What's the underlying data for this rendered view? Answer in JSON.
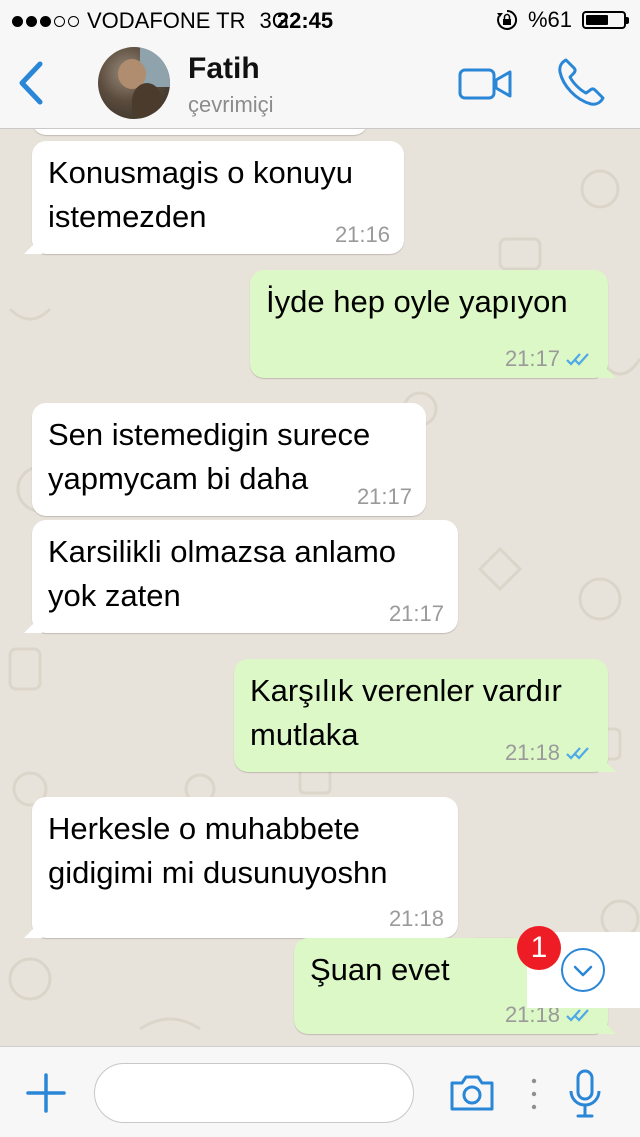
{
  "status_bar": {
    "carrier": "VODAFONE TR",
    "network": "3G",
    "time": "22:45",
    "battery_percent_label": "%61",
    "battery_level": 0.61,
    "signal_bars_filled": 3,
    "signal_bars_total": 5
  },
  "header": {
    "back_icon": "chevron-left-icon",
    "contact_name": "Fatih",
    "contact_status": "çevrimiçi",
    "video_icon": "video-camera-icon",
    "call_icon": "phone-icon"
  },
  "messages": [
    {
      "direction": "in",
      "text_lines": [
        "Konusmagis o konuyu",
        "istemezden"
      ],
      "time": "21:16"
    },
    {
      "direction": "out",
      "text_lines": [
        "İyde hep oyle yapıyon"
      ],
      "time": "21:17",
      "read": true
    },
    {
      "direction": "in",
      "text_lines": [
        "Sen istemedigin surece",
        "yapmycam bi daha"
      ],
      "time": "21:17"
    },
    {
      "direction": "in",
      "text_lines": [
        "Karsilikli olmazsa anlamo",
        "yok zaten"
      ],
      "time": "21:17"
    },
    {
      "direction": "out",
      "text_lines": [
        "Karşılık verenler vardır",
        "mutlaka"
      ],
      "time": "21:18",
      "read": true
    },
    {
      "direction": "in",
      "text_lines": [
        "Herkesle o muhabbete",
        "gidigimi mi dusunuyoshn"
      ],
      "time": "21:18"
    },
    {
      "direction": "out",
      "text_lines": [
        "Şuan evet"
      ],
      "time": "21:18",
      "read": true
    }
  ],
  "scroll_down": {
    "icon": "chevron-down-circle-icon",
    "unread_count": "1"
  },
  "input_bar": {
    "plus_icon": "plus-icon",
    "message_value": "",
    "camera_icon": "camera-icon",
    "mic_icon": "microphone-icon"
  },
  "colors": {
    "accent": "#2a86d6",
    "incoming_bubble": "#ffffff",
    "outgoing_bubble": "#dcf8c6",
    "chat_background": "#e8e3da",
    "badge": "#ee1c24",
    "read_ticks": "#4fa8e8"
  }
}
